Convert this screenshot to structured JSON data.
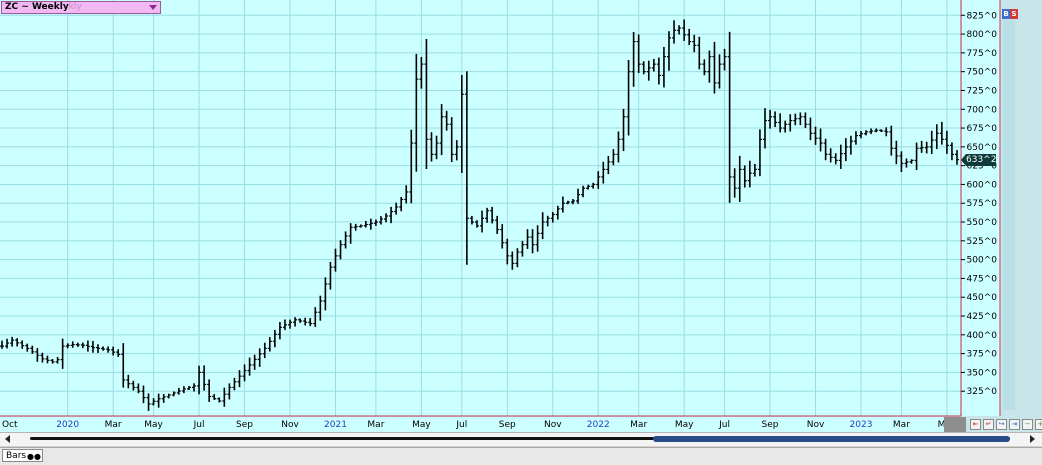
{
  "symbol": {
    "label": "ZC ~ Weekly",
    "ghost": "kly"
  },
  "last_price": "633^2",
  "top_buttons": [
    "B",
    "S"
  ],
  "footer": {
    "tab_label": "Bars"
  },
  "colors": {
    "plot_bg": "#ccffff",
    "grid": "#99dde5",
    "frame": "#cc3355",
    "bars": "#000000"
  },
  "chart_data": {
    "type": "ohlc",
    "title": "ZC ~ Weekly",
    "ylim": [
      300,
      840
    ],
    "y_ticks": [
      {
        "value": 325,
        "label": "325^0"
      },
      {
        "value": 350,
        "label": "350^0"
      },
      {
        "value": 375,
        "label": "375^0"
      },
      {
        "value": 400,
        "label": "400^0"
      },
      {
        "value": 425,
        "label": "425^0"
      },
      {
        "value": 450,
        "label": "450^0"
      },
      {
        "value": 475,
        "label": "475^0"
      },
      {
        "value": 500,
        "label": "500^0"
      },
      {
        "value": 525,
        "label": "525^0"
      },
      {
        "value": 550,
        "label": "550^0"
      },
      {
        "value": 575,
        "label": "575^0"
      },
      {
        "value": 600,
        "label": "600^0"
      },
      {
        "value": 625,
        "label": "625^0"
      },
      {
        "value": 650,
        "label": "650^0"
      },
      {
        "value": 675,
        "label": "675^0"
      },
      {
        "value": 700,
        "label": "700^0"
      },
      {
        "value": 725,
        "label": "725^0"
      },
      {
        "value": 750,
        "label": "750^0"
      },
      {
        "value": 775,
        "label": "775^0"
      },
      {
        "value": 800,
        "label": "800^0"
      },
      {
        "value": 825,
        "label": "825^0"
      }
    ],
    "x_ticks": [
      {
        "label": "Oct",
        "week": 0,
        "year": false
      },
      {
        "label": "2020",
        "week": 13,
        "year": true
      },
      {
        "label": "Mar",
        "week": 22,
        "year": false
      },
      {
        "label": "May",
        "week": 30,
        "year": false
      },
      {
        "label": "Jul",
        "week": 39,
        "year": false
      },
      {
        "label": "Sep",
        "week": 48,
        "year": false
      },
      {
        "label": "Nov",
        "week": 57,
        "year": false
      },
      {
        "label": "2021",
        "week": 66,
        "year": true
      },
      {
        "label": "Mar",
        "week": 74,
        "year": false
      },
      {
        "label": "May",
        "week": 83,
        "year": false
      },
      {
        "label": "Jul",
        "week": 91,
        "year": false
      },
      {
        "label": "Sep",
        "week": 100,
        "year": false
      },
      {
        "label": "Nov",
        "week": 109,
        "year": false
      },
      {
        "label": "2022",
        "week": 118,
        "year": true
      },
      {
        "label": "Mar",
        "week": 126,
        "year": false
      },
      {
        "label": "May",
        "week": 135,
        "year": false
      },
      {
        "label": "Jul",
        "week": 143,
        "year": false
      },
      {
        "label": "Sep",
        "week": 152,
        "year": false
      },
      {
        "label": "Nov",
        "week": 161,
        "year": false
      },
      {
        "label": "2023",
        "week": 170,
        "year": true
      },
      {
        "label": "Mar",
        "week": 178,
        "year": false
      },
      {
        "label": "May",
        "week": 187,
        "year": false
      }
    ],
    "anchors": [
      [
        0,
        385
      ],
      [
        2,
        393
      ],
      [
        5,
        382
      ],
      [
        8,
        368
      ],
      [
        10,
        364
      ],
      [
        11,
        367
      ],
      [
        12,
        385
      ],
      [
        14,
        387
      ],
      [
        16,
        386
      ],
      [
        18,
        383
      ],
      [
        21,
        380
      ],
      [
        23,
        374
      ],
      [
        24,
        340
      ],
      [
        27,
        325
      ],
      [
        29,
        308
      ],
      [
        31,
        315
      ],
      [
        33,
        320
      ],
      [
        36,
        328
      ],
      [
        38,
        332
      ],
      [
        39,
        350
      ],
      [
        41,
        318
      ],
      [
        43,
        312
      ],
      [
        45,
        330
      ],
      [
        47,
        345
      ],
      [
        49,
        360
      ],
      [
        52,
        382
      ],
      [
        55,
        410
      ],
      [
        58,
        420
      ],
      [
        61,
        415
      ],
      [
        63,
        445
      ],
      [
        65,
        490
      ],
      [
        67,
        520
      ],
      [
        69,
        543
      ],
      [
        71,
        545
      ],
      [
        74,
        550
      ],
      [
        76,
        558
      ],
      [
        78,
        570
      ],
      [
        80,
        590
      ],
      [
        81,
        655
      ],
      [
        82,
        740
      ],
      [
        83,
        760
      ],
      [
        84,
        660
      ],
      [
        85,
        640
      ],
      [
        86,
        655
      ],
      [
        87,
        690
      ],
      [
        88,
        680
      ],
      [
        89,
        640
      ],
      [
        90,
        650
      ],
      [
        91,
        720
      ],
      [
        92,
        555
      ],
      [
        94,
        545
      ],
      [
        96,
        565
      ],
      [
        98,
        540
      ],
      [
        100,
        505
      ],
      [
        101,
        495
      ],
      [
        102,
        510
      ],
      [
        104,
        530
      ],
      [
        105,
        520
      ],
      [
        107,
        550
      ],
      [
        109,
        560
      ],
      [
        111,
        575
      ],
      [
        113,
        578
      ],
      [
        115,
        595
      ],
      [
        117,
        600
      ],
      [
        119,
        620
      ],
      [
        121,
        640
      ],
      [
        122,
        660
      ],
      [
        123,
        690
      ],
      [
        124,
        750
      ],
      [
        125,
        790
      ],
      [
        126,
        760
      ],
      [
        127,
        750
      ],
      [
        129,
        760
      ],
      [
        130,
        745
      ],
      [
        131,
        770
      ],
      [
        132,
        795
      ],
      [
        133,
        805
      ],
      [
        134,
        808
      ],
      [
        136,
        790
      ],
      [
        137,
        785
      ],
      [
        138,
        760
      ],
      [
        139,
        750
      ],
      [
        140,
        770
      ],
      [
        141,
        735
      ],
      [
        142,
        760
      ],
      [
        143,
        770
      ],
      [
        144,
        610
      ],
      [
        145,
        595
      ],
      [
        146,
        620
      ],
      [
        147,
        605
      ],
      [
        148,
        615
      ],
      [
        149,
        620
      ],
      [
        150,
        660
      ],
      [
        151,
        685
      ],
      [
        152,
        690
      ],
      [
        154,
        675
      ],
      [
        156,
        685
      ],
      [
        158,
        690
      ],
      [
        159,
        680
      ],
      [
        160,
        668
      ],
      [
        162,
        655
      ],
      [
        163,
        640
      ],
      [
        165,
        632
      ],
      [
        167,
        650
      ],
      [
        169,
        665
      ],
      [
        171,
        670
      ],
      [
        173,
        672
      ],
      [
        175,
        670
      ],
      [
        176,
        648
      ],
      [
        178,
        628
      ],
      [
        180,
        632
      ],
      [
        181,
        648
      ],
      [
        183,
        650
      ],
      [
        185,
        668
      ],
      [
        187,
        652
      ],
      [
        188,
        640
      ],
      [
        189,
        633
      ]
    ],
    "total_weeks": 190
  }
}
